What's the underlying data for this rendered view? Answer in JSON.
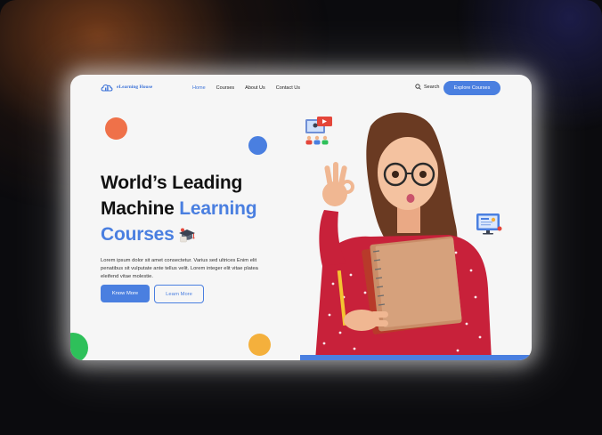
{
  "brand": {
    "name": "eLearning House",
    "accent": "#4a7fe0"
  },
  "nav": {
    "items": [
      {
        "label": "Home",
        "active": true
      },
      {
        "label": "Courses",
        "active": false
      },
      {
        "label": "About Us",
        "active": false
      },
      {
        "label": "Contact Us",
        "active": false
      }
    ],
    "search_label": "Search",
    "explore_label": "Explore Courses"
  },
  "hero": {
    "title_line1": "World’s Leading",
    "title_line2_dark": "Machine ",
    "title_line2_blue": "Learning",
    "title_line3_blue": "Courses",
    "description": "Lorem ipsum dolor sit amet consectetur. Varius sed ultrices Enim elit penatibus sit vulputate ante tellus velit. Lorem integer elit vitae platea eleifend vitae molestie.",
    "primary_button": "Know More",
    "secondary_button": "Learn More"
  },
  "decor": {
    "orange": "#ef7149",
    "blue": "#4a7fe0",
    "green": "#2ec05a",
    "yellow": "#f4b03c"
  },
  "icons": [
    "cloud-logo-icon",
    "search-icon",
    "graduation-cap-icon",
    "video-lesson-icon",
    "online-board-icon"
  ]
}
